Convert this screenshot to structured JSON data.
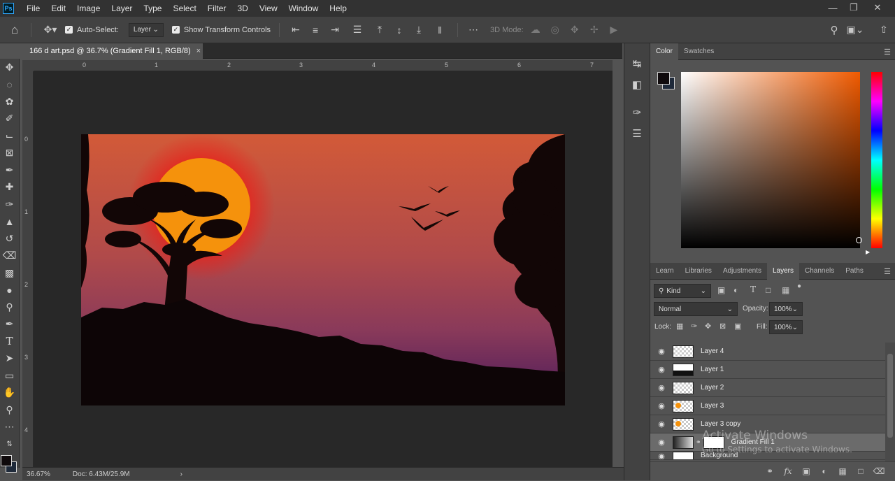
{
  "app": {
    "logo": "Ps"
  },
  "menu": [
    "File",
    "Edit",
    "Image",
    "Layer",
    "Type",
    "Select",
    "Filter",
    "3D",
    "View",
    "Window",
    "Help"
  ],
  "options": {
    "auto_select_label": "Auto-Select:",
    "auto_select_target": "Layer",
    "show_transform_label": "Show Transform Controls",
    "mode_3d_label": "3D Mode:"
  },
  "document": {
    "tab_title": "166 d art.psd @ 36.7% (Gradient Fill 1, RGB/8)",
    "close_glyph": "×"
  },
  "ruler": {
    "h_ticks": [
      "0",
      "1",
      "2",
      "3",
      "4",
      "5",
      "6",
      "7"
    ],
    "v_ticks": [
      "0",
      "1",
      "2",
      "3",
      "4"
    ]
  },
  "status": {
    "zoom": "36.67%",
    "doc_size": "Doc: 6.43M/25.9M",
    "arrow": "›"
  },
  "color_panel": {
    "tabs": [
      "Color",
      "Swatches"
    ],
    "active_tab": "Color",
    "foreground": "#0f0a0c",
    "background": "#1f2a3a",
    "hue_base": "#f05a00"
  },
  "layers_panel": {
    "tabs": [
      "Learn",
      "Libraries",
      "Adjustments",
      "Layers",
      "Channels",
      "Paths"
    ],
    "active_tab": "Layers",
    "filter_kind": "Kind",
    "blend_mode": "Normal",
    "opacity_label": "Opacity:",
    "opacity_value": "100%",
    "lock_label": "Lock:",
    "fill_label": "Fill:",
    "fill_value": "100%",
    "layers": [
      {
        "name": "Layer 4"
      },
      {
        "name": "Layer 1"
      },
      {
        "name": "Layer 2"
      },
      {
        "name": "Layer 3"
      },
      {
        "name": "Layer 3 copy"
      },
      {
        "name": "Gradient Fill 1"
      },
      {
        "name": "Background"
      }
    ],
    "selected_layer": "Gradient Fill 1"
  },
  "watermark": {
    "title": "Activate Windows",
    "subtitle": "Go to Settings to activate Windows."
  }
}
